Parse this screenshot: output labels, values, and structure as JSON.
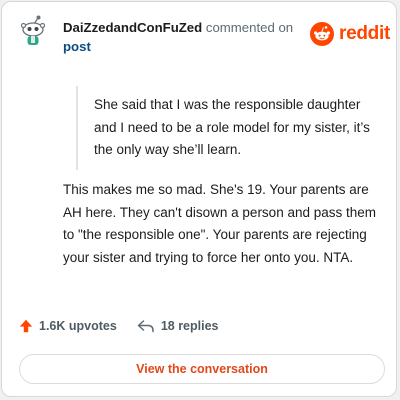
{
  "header": {
    "username": "DaiZzedandConFuZed",
    "commented_text": "commented on",
    "post_label": "post",
    "avatar_icon": "snoo-avatar-icon"
  },
  "brand": {
    "name": "reddit",
    "logo_icon": "reddit-logo-icon",
    "color": "#ff4500"
  },
  "comment": {
    "quote": "She said that I was the responsible daughter and I need to be a role model for my sister, it’s the only way she’ll learn.",
    "body": "This makes me so mad. She's 19. Your parents are AH here. They can't disown a person and pass them to \"the responsible one\". Your parents are rejecting your sister and trying to force her onto you. NTA."
  },
  "actions": {
    "upvotes": "1.6K upvotes",
    "upvote_icon": "upvote-arrow-icon",
    "replies": "18 replies",
    "reply_icon": "reply-arrow-icon"
  },
  "cta": {
    "label": "View the conversation"
  }
}
